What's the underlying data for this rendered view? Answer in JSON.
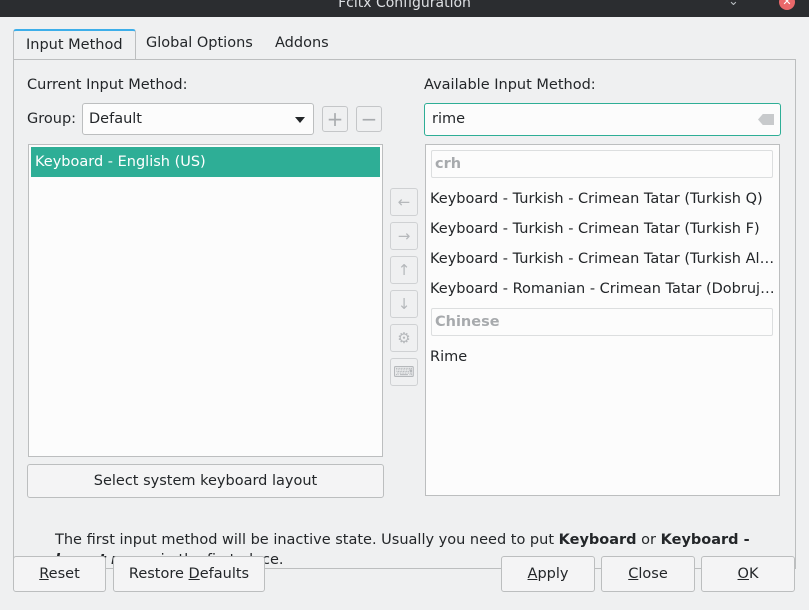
{
  "window": {
    "title": "Fcitx Configuration",
    "minimize_glyph": "⌄",
    "maximize_glyph": "⌃",
    "close_glyph": "✕"
  },
  "tabs": [
    {
      "label": "Input Method"
    },
    {
      "label": "Global Options"
    },
    {
      "label": "Addons"
    }
  ],
  "current": {
    "heading": "Current Input Method:",
    "group_label": "Group:",
    "group_value": "Default",
    "add_glyph": "+",
    "remove_glyph": "−",
    "items": [
      "Keyboard - English (US)"
    ],
    "select_layout_button": "Select system keyboard layout"
  },
  "available": {
    "heading": "Available Input Method:",
    "search_value": "rime",
    "groups": [
      {
        "header": "crh",
        "items": [
          "Keyboard - Turkish - Crimean Tatar (Turkish Q)",
          "Keyboard - Turkish - Crimean Tatar (Turkish F)",
          "Keyboard - Turkish - Crimean Tatar (Turkish Alt-Q)",
          "Keyboard - Romanian - Crimean Tatar (Dobruja Q)"
        ]
      },
      {
        "header": "Chinese",
        "items": [
          "Rime"
        ]
      }
    ]
  },
  "middle_buttons": {
    "left": "←",
    "right": "→",
    "up": "↑",
    "down": "↓",
    "configure": "⚙",
    "layout": "⌨"
  },
  "info": {
    "part1": "The first input method will be inactive state. Usually you need to put ",
    "bold1": "Keyboard",
    "part2": " or ",
    "bold2": "Keyboard - ",
    "bolditalic": "layout name",
    "part3": " in the first place."
  },
  "dialog_buttons": {
    "reset": {
      "mnemonic": "R",
      "rest": "eset"
    },
    "restore_defaults": {
      "pre": "Restore ",
      "mnemonic": "D",
      "rest": "efaults"
    },
    "apply": {
      "mnemonic": "A",
      "rest": "pply"
    },
    "close": {
      "mnemonic": "C",
      "rest": "lose"
    },
    "ok": {
      "mnemonic": "O",
      "rest": "K"
    }
  }
}
